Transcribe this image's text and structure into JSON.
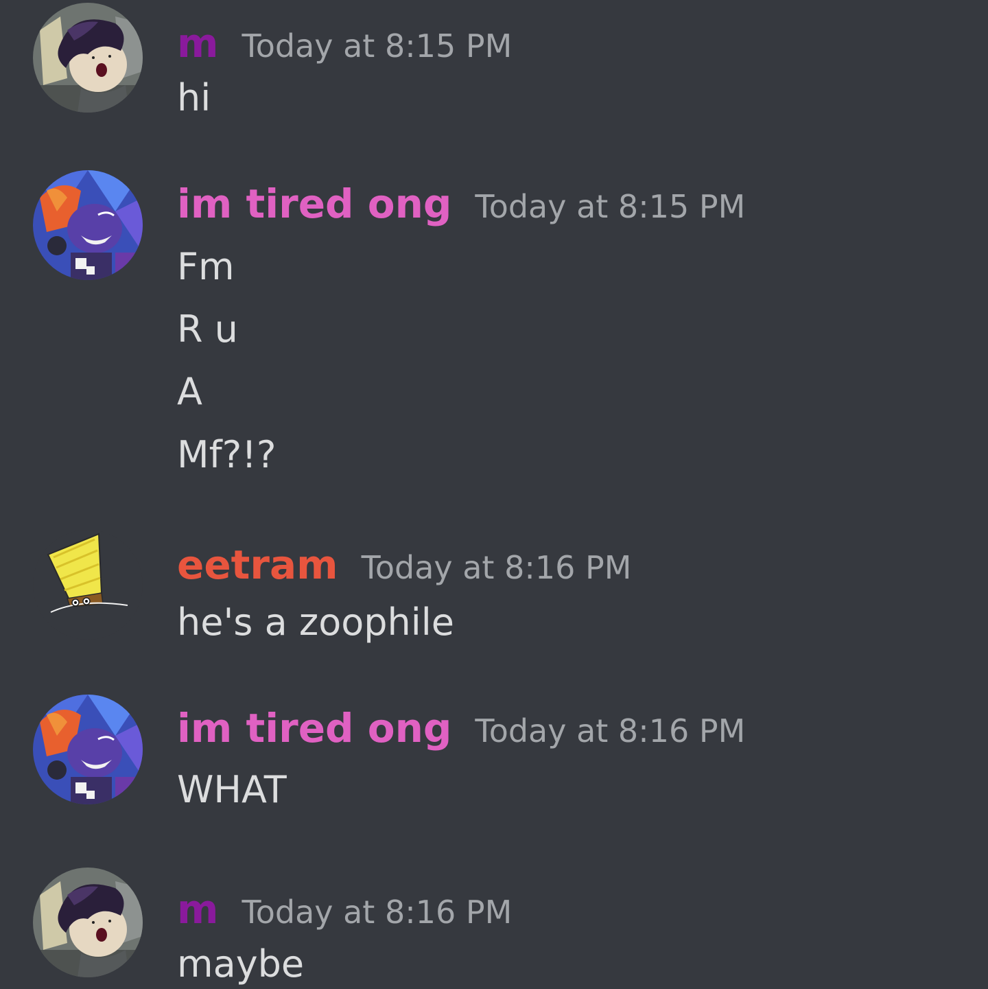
{
  "colors": {
    "background": "#36393f",
    "user_m": "#8a1a9c",
    "user_im_tired_ong": "#e061c2",
    "user_eetram": "#e8553e",
    "timestamp": "#a3a6aa",
    "text": "#dcddde"
  },
  "messages": [
    {
      "author": "m",
      "avatar": "dark-haired-character-avatar",
      "timestamp": "Today at 8:15 PM",
      "lines": [
        "hi"
      ]
    },
    {
      "author": "im tired ong",
      "avatar": "fox-character-avatar",
      "timestamp": "Today at 8:15 PM",
      "lines": [
        "Fm",
        "R u",
        "A",
        "Mf?!?"
      ]
    },
    {
      "author": "eetram",
      "avatar": "yellow-hat-avatar",
      "timestamp": "Today at 8:16 PM",
      "lines": [
        "he's a zoophile"
      ]
    },
    {
      "author": "im tired ong",
      "avatar": "fox-character-avatar",
      "timestamp": "Today at 8:16 PM",
      "lines": [
        "WHAT"
      ]
    },
    {
      "author": "m",
      "avatar": "dark-haired-character-avatar",
      "timestamp": "Today at 8:16 PM",
      "lines": [
        "maybe"
      ]
    }
  ]
}
